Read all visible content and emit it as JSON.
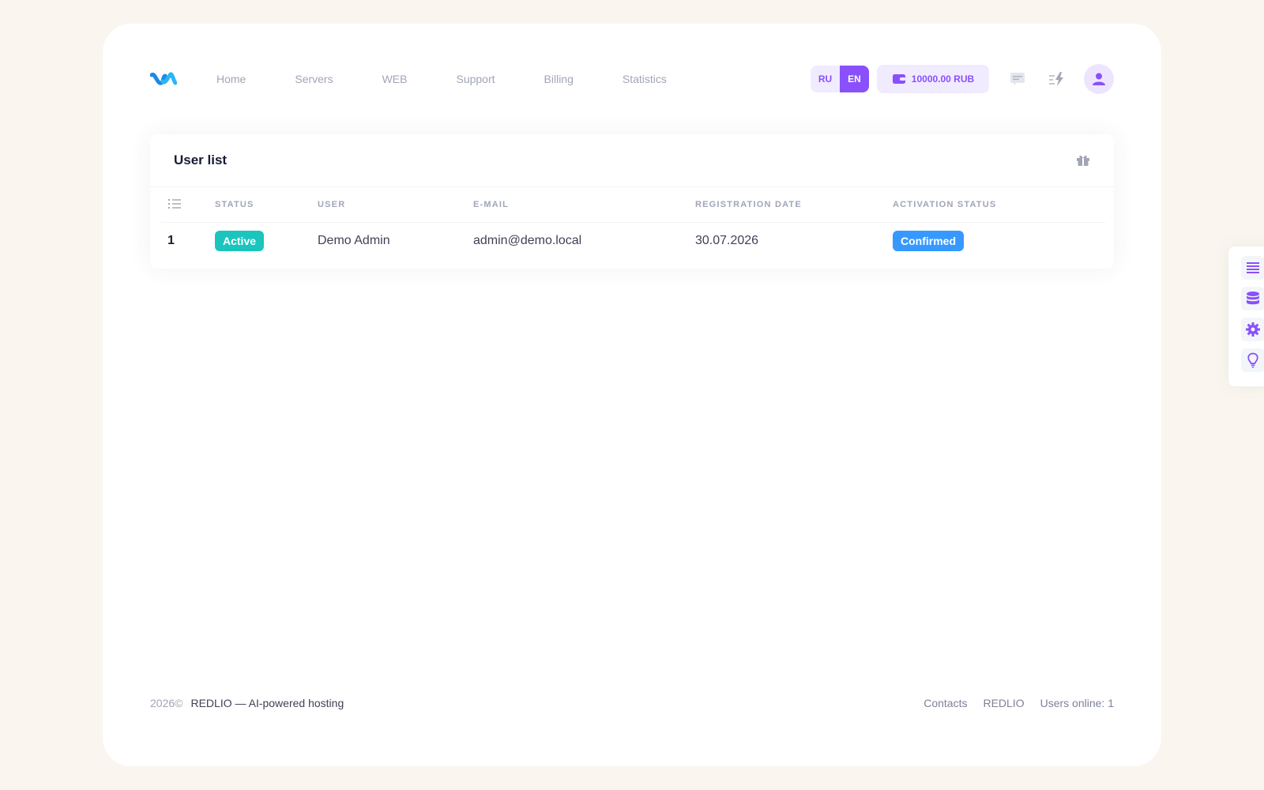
{
  "header": {
    "logo_icon": "brand-wave-icon",
    "nav": [
      {
        "label": "Home"
      },
      {
        "label": "Servers"
      },
      {
        "label": "WEB"
      },
      {
        "label": "Support"
      },
      {
        "label": "Billing"
      },
      {
        "label": "Statistics"
      }
    ],
    "lang": {
      "ru": "RU",
      "en": "EN",
      "active": "EN"
    },
    "balance": {
      "icon": "wallet-icon",
      "value": "10000.00 RUB"
    },
    "icons": [
      "chat-icon",
      "lightning-icon",
      "user-avatar-icon"
    ]
  },
  "card": {
    "title": "User list",
    "action_icon": "gift-icon",
    "columns": [
      "STATUS",
      "USER",
      "E-MAIL",
      "REGISTRATION DATE",
      "ACTIVATION STATUS"
    ],
    "index_icon": "numbered-list-icon",
    "rows": [
      {
        "index": "1",
        "status": "Active",
        "user": "Demo Admin",
        "email": "admin@demo.local",
        "registration_date": "30.07.2026",
        "activation_status": "Confirmed"
      }
    ]
  },
  "footer": {
    "year": "2026©",
    "brand": "REDLIO — AI-powered hosting",
    "links": [
      "Contacts",
      "REDLIO",
      "Users online: 1"
    ]
  },
  "side_panel": {
    "icons": [
      "list-icon",
      "database-icon",
      "settings-gear-icon",
      "lightbulb-icon"
    ]
  },
  "colors": {
    "accent": "#8950fc",
    "active_badge": "#1bc5bd",
    "confirmed_badge": "#3699ff",
    "background": "#faf6ef"
  }
}
